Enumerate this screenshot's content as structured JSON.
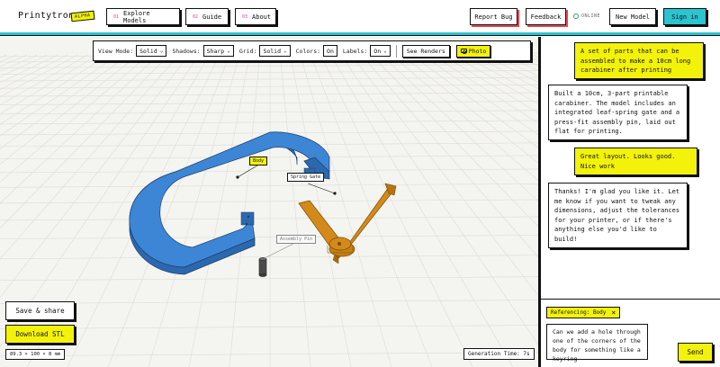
{
  "app": {
    "name": "Printytron",
    "badge": "ALPHA"
  },
  "nav": [
    {
      "num": "01",
      "label": "Explore Models"
    },
    {
      "num": "02",
      "label": "Guide"
    },
    {
      "num": "03",
      "label": "About"
    }
  ],
  "header": {
    "report_bug": "Report Bug",
    "feedback": "Feedback",
    "status": "ONLINE",
    "new_model": "New Model",
    "sign_in": "Sign in"
  },
  "toolbar": {
    "view_mode_label": "View Mode:",
    "view_mode": "Solid",
    "shadows_label": "Shadows:",
    "shadows": "Sharp",
    "grid_label": "Grid:",
    "grid": "Solid",
    "colors_label": "Colors:",
    "colors": "On",
    "labels_label": "Labels:",
    "labels": "On",
    "see_renders": "See Renders",
    "photo": "Photo"
  },
  "scene_labels": {
    "body": "Body",
    "spring_gate": "Spring Gate",
    "assembly_pin": "Assembly Pin"
  },
  "colors": {
    "body": "#3d86d6",
    "gate": "#d48a1a",
    "pin": "#4a4a4a",
    "accent": "#2dc3cf",
    "highlight": "#f3f20a"
  },
  "viewport": {
    "save_share": "Save & share",
    "download": "Download STL",
    "dimensions": "89.3 × 100 × 8 mm",
    "generation_time": "Generation Time: 7s"
  },
  "chat": {
    "messages": [
      {
        "role": "user",
        "text": "A set of parts that can be assembled to make a 10cm long carabiner after printing"
      },
      {
        "role": "assistant",
        "text": "Built a 10cm, 3-part printable carabiner. The model includes an integrated leaf-spring gate and a press-fit assembly pin, laid out flat for printing."
      },
      {
        "role": "user",
        "text": "Great layout. Looks good. Nice work"
      },
      {
        "role": "assistant",
        "text": "Thanks! I'm glad you like it. Let me know if you want to tweak any dimensions, adjust the tolerances for your printer, or if there's anything else you'd like to build!"
      }
    ],
    "referencing": "Referencing: Body",
    "input_value": "Can we add a hole through one of the corners of the body for something like a keyring",
    "send": "Send"
  }
}
